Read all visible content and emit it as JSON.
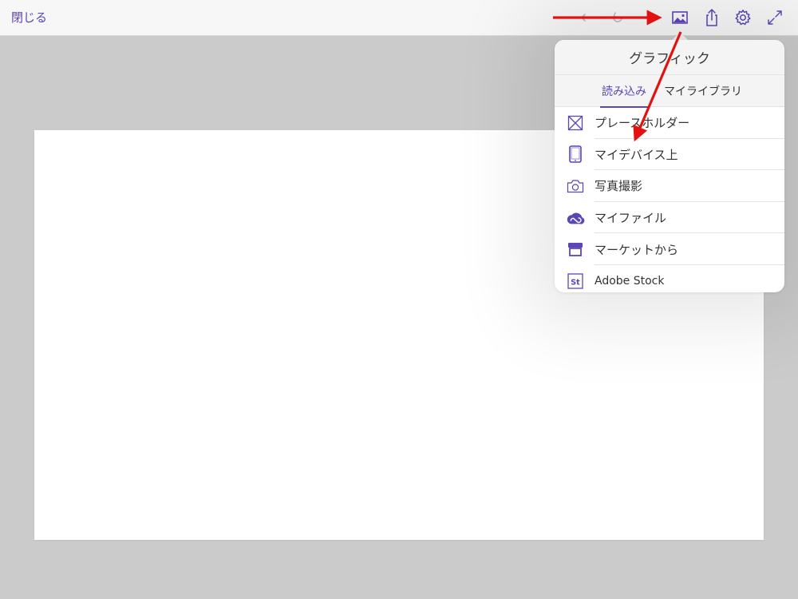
{
  "toolbar": {
    "close_label": "閉じる",
    "icons": {
      "undo": "undo-arrow-icon",
      "redo": "redo-arrow-icon",
      "image": "image-icon",
      "share": "share-icon",
      "settings": "gear-icon",
      "fullscreen": "expand-icon"
    }
  },
  "popover": {
    "title": "グラフィック",
    "tabs": [
      {
        "label": "読み込み",
        "active": true
      },
      {
        "label": "マイライブラリ",
        "active": false
      }
    ],
    "items": [
      {
        "label": "プレースホルダー",
        "icon": "placeholder-frame-icon"
      },
      {
        "label": "マイデバイス上",
        "icon": "tablet-icon"
      },
      {
        "label": "写真撮影",
        "icon": "camera-icon"
      },
      {
        "label": "マイファイル",
        "icon": "creative-cloud-icon"
      },
      {
        "label": "マーケットから",
        "icon": "market-store-icon"
      },
      {
        "label": "Adobe Stock",
        "icon": "adobe-stock-icon"
      }
    ]
  },
  "colors": {
    "accent": "#5b45b8",
    "annotation_arrow": "#e31212",
    "background": "#cbcbcb",
    "canvas": "#ffffff"
  }
}
